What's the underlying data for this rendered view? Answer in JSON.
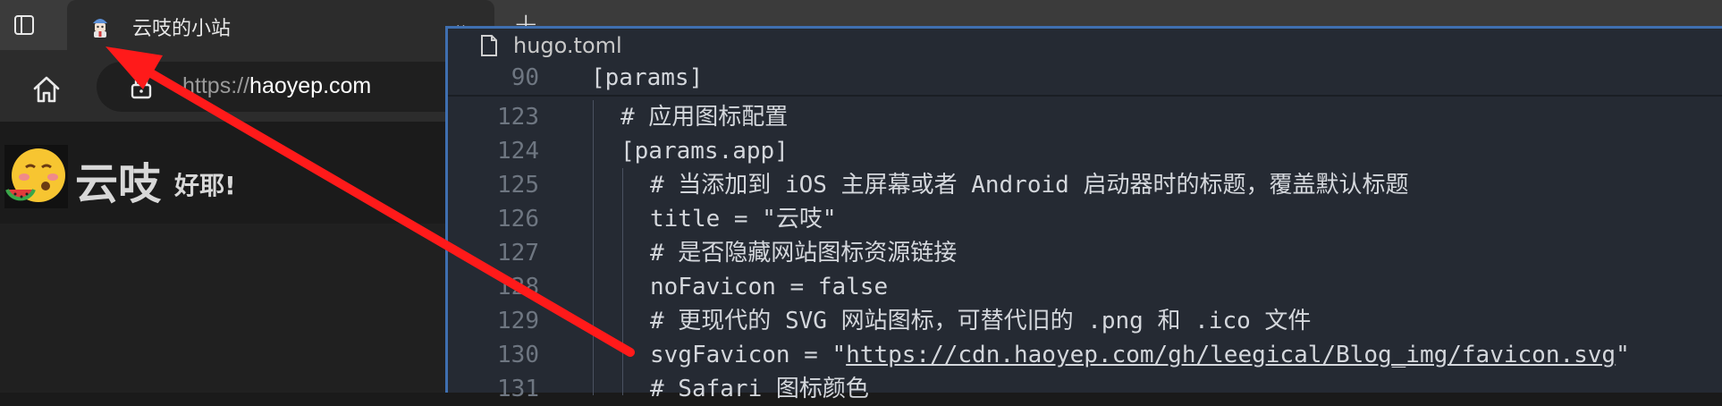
{
  "browser": {
    "tab": {
      "title": "云吱的小站"
    },
    "address": {
      "scheme": "https://",
      "host": "haoyep.com"
    }
  },
  "site": {
    "name": "云吱",
    "tagline": "好耶!"
  },
  "editor": {
    "filename": "hugo.toml",
    "lines": [
      {
        "num": "90",
        "indent": 0,
        "text": "[params]"
      },
      {
        "num": "123",
        "indent": 1,
        "text": "# 应用图标配置"
      },
      {
        "num": "124",
        "indent": 1,
        "text": "[params.app]"
      },
      {
        "num": "125",
        "indent": 2,
        "text": "# 当添加到 iOS 主屏幕或者 Android 启动器时的标题，覆盖默认标题"
      },
      {
        "num": "126",
        "indent": 2,
        "text": "title = \"云吱\""
      },
      {
        "num": "127",
        "indent": 2,
        "text": "# 是否隐藏网站图标资源链接"
      },
      {
        "num": "128",
        "indent": 2,
        "text": "noFavicon = false"
      },
      {
        "num": "129",
        "indent": 2,
        "text": "# 更现代的 SVG 网站图标，可替代旧的 .png 和 .ico 文件"
      },
      {
        "num": "130",
        "indent": 2,
        "text": "svgFavicon = \"",
        "link": "https://cdn.haoyep.com/gh/leegical/Blog_img/favicon.svg",
        "suffix": "\""
      },
      {
        "num": "131",
        "indent": 2,
        "text": "# Safari 图标颜色"
      }
    ]
  },
  "colors": {
    "annotation_arrow": "#ff1a1a",
    "editor_border": "#3f6fb0"
  }
}
